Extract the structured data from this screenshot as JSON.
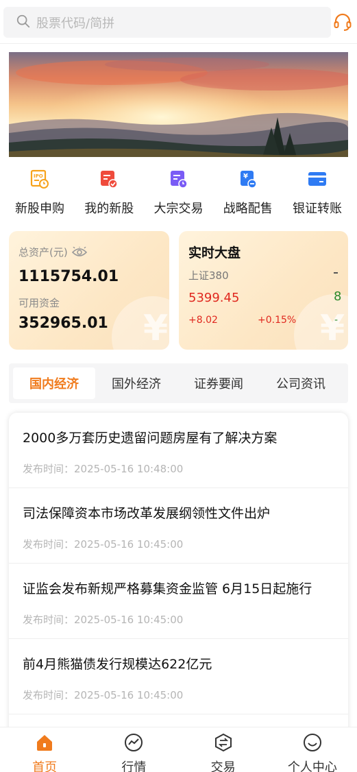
{
  "search": {
    "placeholder": "股票代码/简拼"
  },
  "icons": {
    "search": "search-icon",
    "service": "headset-icon"
  },
  "colors": {
    "accent": "#f07b1d",
    "up": "#e0281f",
    "down": "#2a8a2a"
  },
  "shortcuts": [
    {
      "label": "新股申购",
      "icon": "ipo-clock-icon",
      "color": "#f7a21b"
    },
    {
      "label": "我的新股",
      "icon": "doc-check-icon",
      "color": "#ef4b3c"
    },
    {
      "label": "大宗交易",
      "icon": "doc-clock-icon",
      "color": "#7a5cf5"
    },
    {
      "label": "战略配售",
      "icon": "yen-doc-icon",
      "color": "#2f7bf3"
    },
    {
      "label": "银证转账",
      "icon": "card-icon",
      "color": "#2f7bf3"
    }
  ],
  "assets": {
    "total_label": "总资产(元)",
    "total_value": "1115754.01",
    "available_label": "可用资金",
    "available_value": "352965.01"
  },
  "market": {
    "title": "实时大盘",
    "index_name": "上证380",
    "price": "5399.45",
    "change": "+8.02",
    "change_pct": "+0.15%",
    "next_fragment_price": "8",
    "next_fragment_change": "-"
  },
  "tabs": [
    {
      "label": "国内经济",
      "active": true
    },
    {
      "label": "国外经济",
      "active": false
    },
    {
      "label": "证券要闻",
      "active": false
    },
    {
      "label": "公司资讯",
      "active": false
    }
  ],
  "news": [
    {
      "title": "2000多万套历史遗留问题房屋有了解决方案",
      "time": "发布时间：2025-05-16 10:48:00"
    },
    {
      "title": "司法保障资本市场改革发展纲领性文件出炉",
      "time": "发布时间：2025-05-16 10:45:00"
    },
    {
      "title": "证监会发布新规严格募集资金监管 6月15日起施行",
      "time": "发布时间：2025-05-16 10:45:00"
    },
    {
      "title": "前4月熊猫债发行规模达622亿元",
      "time": "发布时间：2025-05-16 10:45:00"
    }
  ],
  "bottom_nav": [
    {
      "label": "首页",
      "icon": "home-icon",
      "active": true
    },
    {
      "label": "行情",
      "icon": "chart-icon",
      "active": false
    },
    {
      "label": "交易",
      "icon": "exchange-icon",
      "active": false
    },
    {
      "label": "个人中心",
      "icon": "smile-icon",
      "active": false
    }
  ]
}
